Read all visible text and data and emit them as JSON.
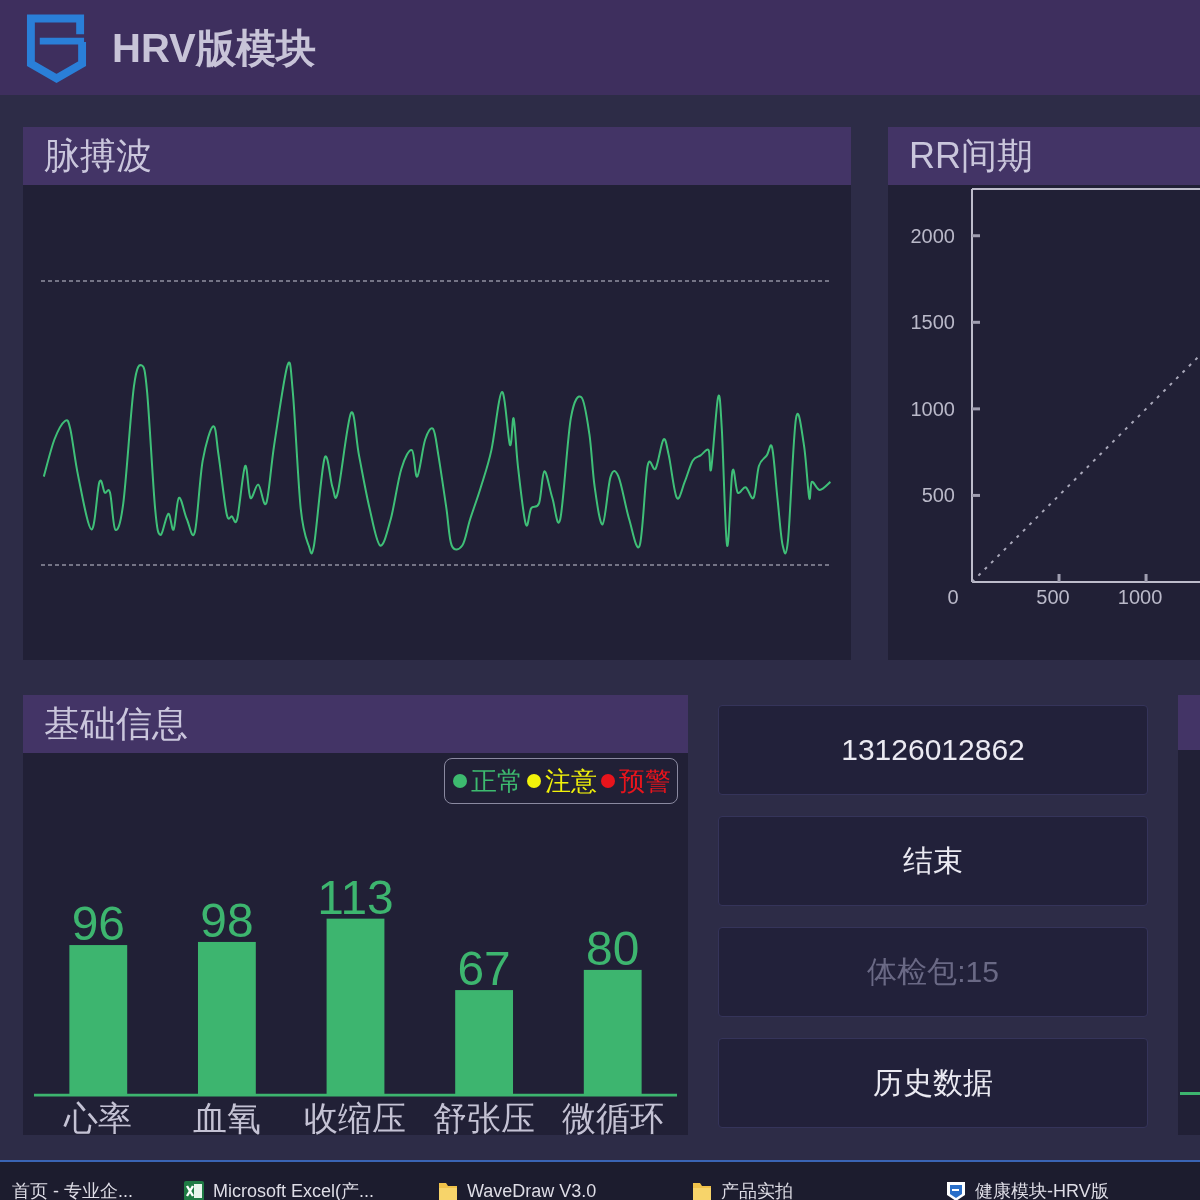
{
  "header": {
    "title": "HRV版模块"
  },
  "pulse_wave": {
    "title": "脉搏波"
  },
  "rr_interval": {
    "title": "RR间期",
    "chart_data": {
      "type": "line",
      "line_style": "dotted",
      "x": [
        0,
        500,
        1000,
        1310
      ],
      "values": [
        0,
        500,
        1000,
        1310
      ],
      "xlim": [
        0,
        1310
      ],
      "ylim": [
        0,
        2270
      ],
      "xticks": [
        0,
        500,
        1000
      ],
      "yticks": [
        500,
        1000,
        1500,
        2000
      ]
    }
  },
  "basic_info": {
    "title": "基础信息",
    "legend": [
      {
        "label": "正常",
        "color": "#3dba6f"
      },
      {
        "label": "注意",
        "color": "#f2f20a"
      },
      {
        "label": "预警",
        "color": "#e8141c"
      }
    ],
    "chart_data": {
      "type": "bar",
      "categories": [
        "心率",
        "血氧",
        "收缩压",
        "舒张压",
        "微循环"
      ],
      "values": [
        96,
        98,
        113,
        67,
        80
      ],
      "data_labels": true
    }
  },
  "actions": [
    {
      "label": "13126012862",
      "disabled": false
    },
    {
      "label": "结束",
      "disabled": false
    },
    {
      "label": "体检包:15",
      "disabled": true
    },
    {
      "label": "历史数据",
      "disabled": false
    }
  ],
  "taskbar": {
    "items": [
      {
        "label": "首页 - 专业企...",
        "kind": "plain"
      },
      {
        "label": "Microsoft Excel(产...",
        "kind": "spreadsheet"
      },
      {
        "label": "WaveDraw V3.0",
        "kind": "folder"
      },
      {
        "label": "产品实拍",
        "kind": "folder"
      },
      {
        "label": "健康模块-HRV版",
        "kind": "app"
      }
    ]
  }
}
